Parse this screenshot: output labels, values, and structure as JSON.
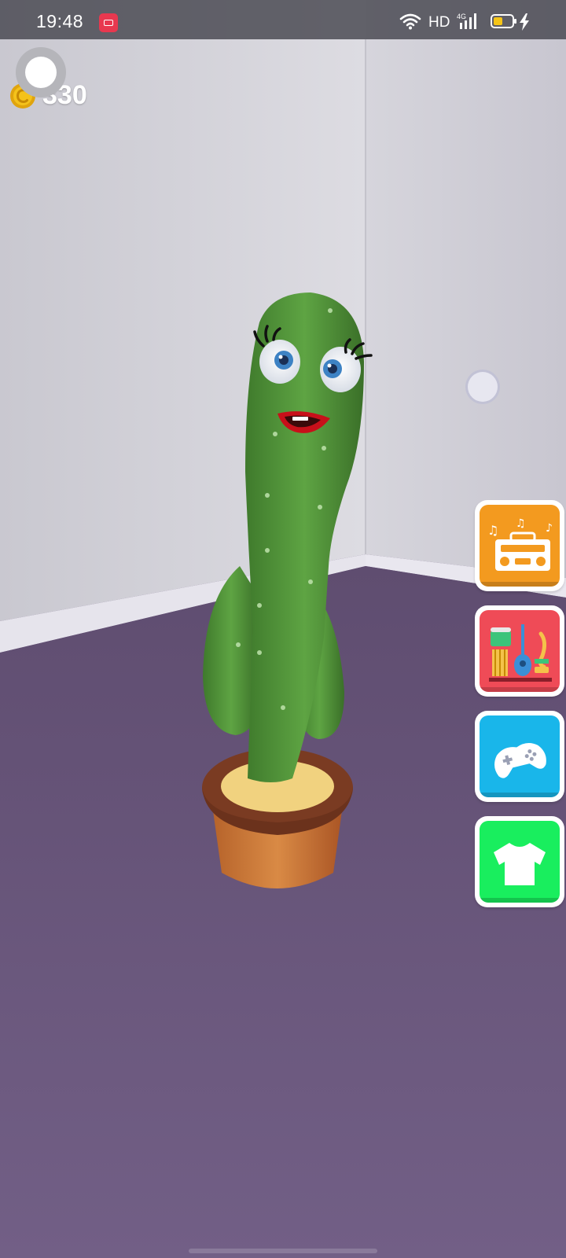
{
  "status_bar": {
    "time": "19:48",
    "network_label": "HD",
    "icons": [
      "screen-record-icon",
      "wifi-icon",
      "signal-4g-icon",
      "battery-icon",
      "charging-icon"
    ],
    "battery_color": "#f5c518"
  },
  "hud": {
    "coins": "330",
    "coin_color": "#f4c21b"
  },
  "side_menu": [
    {
      "name": "music-boombox",
      "icon": "boombox-icon",
      "color": "#f39a1f"
    },
    {
      "name": "instruments",
      "icon": "instruments-icon",
      "color": "#ef4b57"
    },
    {
      "name": "games",
      "icon": "gamepad-icon",
      "color": "#19b6ea"
    },
    {
      "name": "outfits",
      "icon": "tshirt-icon",
      "color": "#19ee5e"
    }
  ],
  "scene": {
    "wall_color": "#d9d8df",
    "floor_color": "#6d5a80",
    "character": "dancing-cactus"
  }
}
